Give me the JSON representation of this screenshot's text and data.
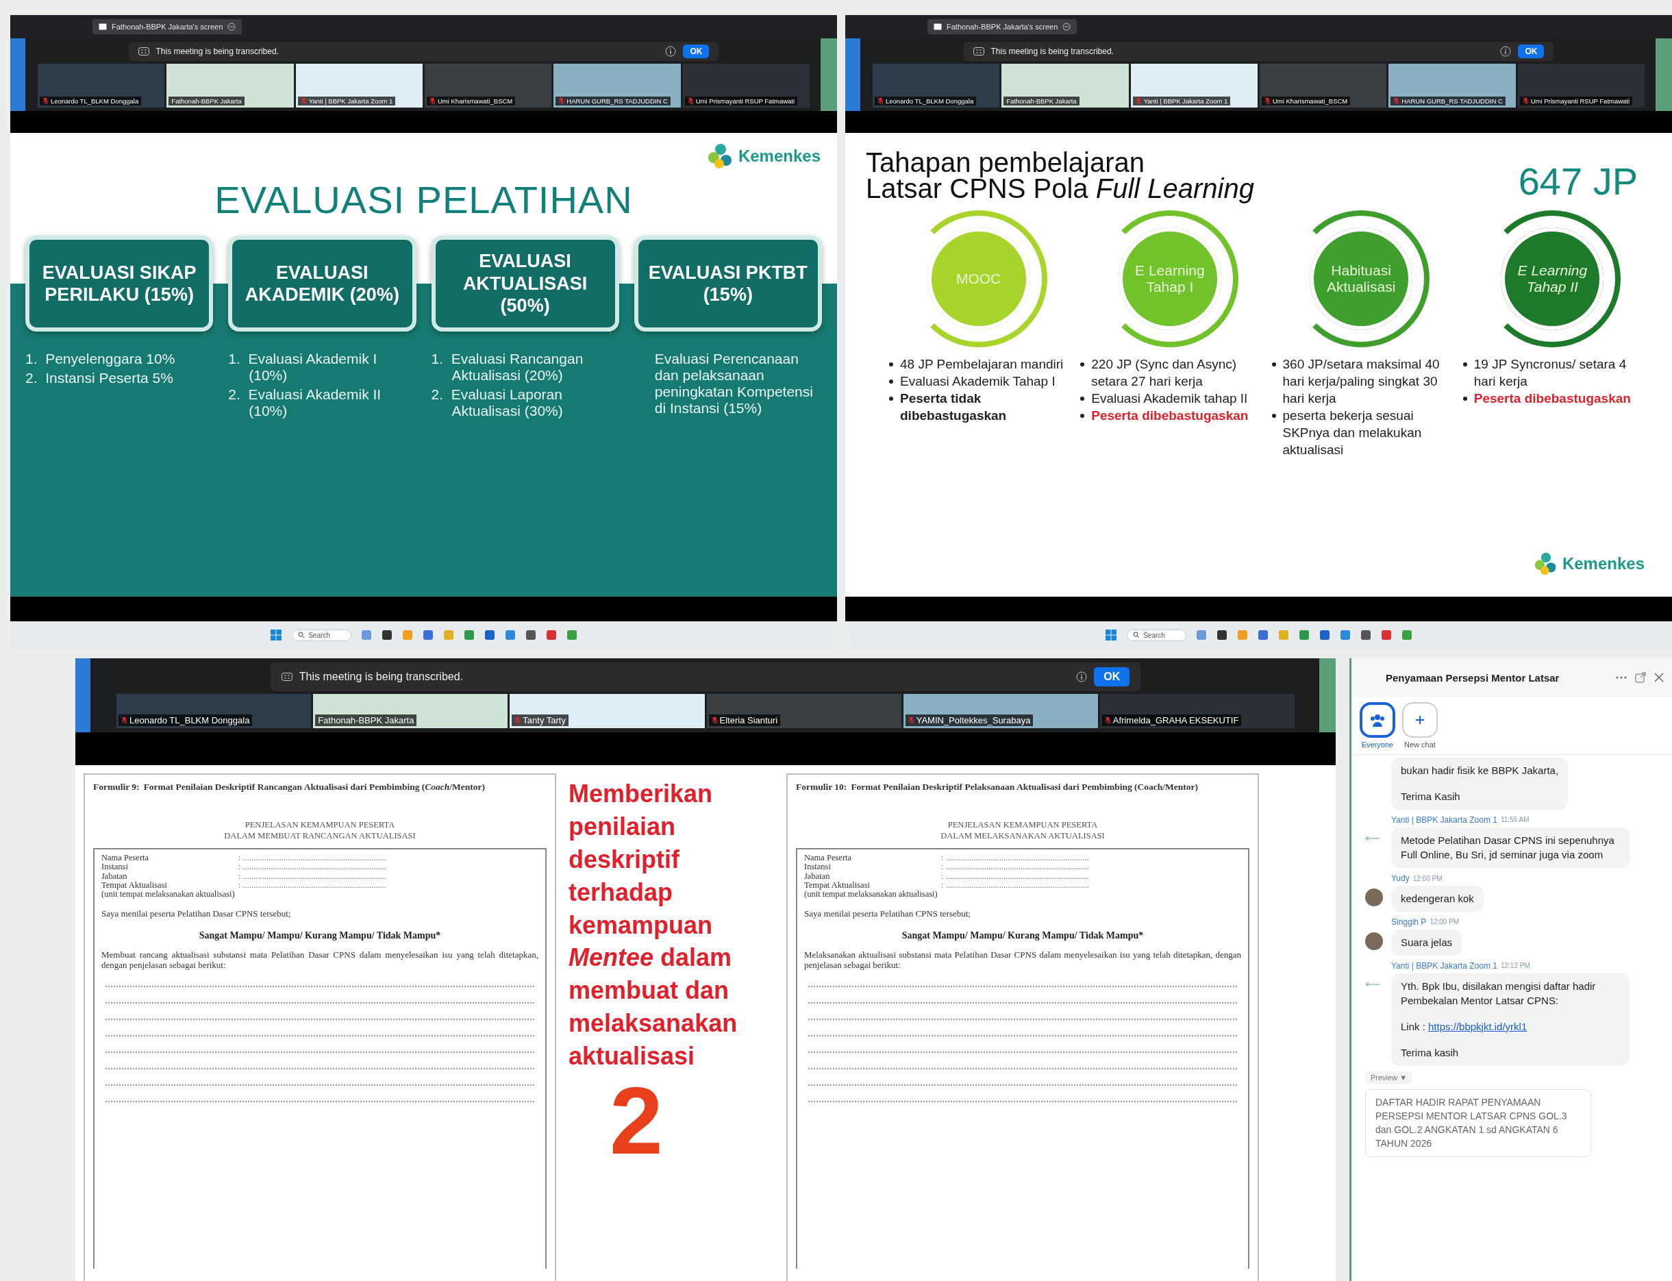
{
  "screens": [
    {
      "share_tab": "Fathonah-BBPK Jakarta's screen",
      "banner": {
        "text": "This meeting is being transcribed.",
        "button": "OK"
      },
      "participants": [
        {
          "name": "Leonardo TL_BLKM Donggala",
          "muted": true
        },
        {
          "name": "Fathonah-BBPK Jakarta",
          "muted": false
        },
        {
          "name": "Yanti | BBPK Jakarta Zoom 1",
          "muted": true
        },
        {
          "name": "Umi Kharismawati_BSCM",
          "muted": true
        },
        {
          "name": "HARUN GURB_RS TADJUDDIN C",
          "muted": true
        },
        {
          "name": "Umi Prismayanti RSUP Fatmawati",
          "muted": true
        }
      ],
      "slide": {
        "kind": "evaluasi",
        "logo": "Kemenkes",
        "title": "EVALUASI PELATIHAN",
        "cards": [
          {
            "title": "EVALUASI SIKAP PERILAKU (15%)",
            "items": [
              {
                "number": "1.",
                "text": "Penyelenggara 10%"
              },
              {
                "number": "2.",
                "text": "Instansi Peserta 5%"
              }
            ]
          },
          {
            "title": "EVALUASI AKADEMIK (20%)",
            "items": [
              {
                "number": "1.",
                "text": "Evaluasi Akademik I (10%)"
              },
              {
                "number": "2.",
                "text": "Evaluasi Akademik II (10%)"
              }
            ]
          },
          {
            "title": "EVALUASI AKTUALISASI (50%)",
            "items": [
              {
                "number": "1.",
                "text": "Evaluasi Rancangan Aktualisasi (20%)"
              },
              {
                "number": "2.",
                "text": "Evaluasi Laporan Aktualisasi (30%)"
              }
            ]
          },
          {
            "title": "EVALUASI PKTBT (15%)",
            "items": [
              {
                "text": "Evaluasi Perencanaan dan pelaksanaan peningkatan Kompetensi di Instansi (15%)"
              }
            ]
          }
        ]
      },
      "taskbar": {
        "search": "Search"
      }
    },
    {
      "share_tab": "Fathonah-BBPK Jakarta's screen",
      "banner": {
        "text": "This meeting is being transcribed.",
        "button": "OK"
      },
      "participants": [
        {
          "name": "Leonardo TL_BLKM Donggala",
          "muted": true
        },
        {
          "name": "Fathonah-BBPK Jakarta",
          "muted": false
        },
        {
          "name": "Yanti | BBPK Jakarta Zoom 1",
          "muted": true
        },
        {
          "name": "Umi Kharismawati_BSCM",
          "muted": true
        },
        {
          "name": "HARUN GURB_RS TADJUDDIN C",
          "muted": true
        },
        {
          "name": "Umi Prismayanti RSUP Fatmawati",
          "muted": true
        }
      ],
      "slide": {
        "kind": "tahapan",
        "title_lines": [
          "Tahapan pembelajaran",
          "Latsar CPNS Pola *Full Learning*"
        ],
        "total": "647 JP",
        "logo": "Kemenkes",
        "stages": [
          {
            "label": "MOOC",
            "italic": false,
            "color": "#a8d42c",
            "bullets": [
              {
                "kind": "plain",
                "text": "48 JP Pembelajaran mandiri"
              },
              {
                "kind": "plain",
                "text": "Evaluasi Akademik Tahap I"
              },
              {
                "kind": "bold",
                "text": "Peserta tidak dibebastugaskan"
              }
            ]
          },
          {
            "label": "E Learning Tahap I",
            "italic": false,
            "color": "#72c22c",
            "bullets": [
              {
                "kind": "plain",
                "text": "220 JP (Sync dan Async) setara 27 hari kerja"
              },
              {
                "kind": "plain",
                "text": "Evaluasi Akademik tahap II"
              },
              {
                "kind": "alert",
                "text": "Peserta dibebastugaskan"
              }
            ]
          },
          {
            "label": "Habituasi Aktualisasi",
            "italic": false,
            "color": "#3e9f2c",
            "bullets": [
              {
                "kind": "plain",
                "text": "360 JP/setara maksimal 40 hari kerja/paling singkat 30 hari kerja"
              },
              {
                "kind": "plain",
                "text": "peserta bekerja sesuai SKPnya dan melakukan aktualisasi"
              }
            ]
          },
          {
            "label": "E Learning Tahap II",
            "italic": true,
            "color": "#1d7a2a",
            "bullets": [
              {
                "kind": "plain",
                "text": "19 JP Syncronus/ setara 4 hari kerja"
              },
              {
                "kind": "alert",
                "text": "Peserta dibebastugaskan"
              }
            ]
          }
        ]
      },
      "taskbar": {
        "search": "Search"
      }
    }
  ],
  "main_meeting": {
    "banner": {
      "text": "This meeting is being transcribed.",
      "button": "OK"
    },
    "participants": [
      {
        "name": "Leonardo TL_BLKM Donggala",
        "muted": true
      },
      {
        "name": "Fathonah-BBPK Jakarta",
        "muted": false
      },
      {
        "name": "Tanty Tarty",
        "muted": true
      },
      {
        "name": "Elteria Sianturi",
        "muted": true
      },
      {
        "name": "YAMIN_Poltekkes_Surabaya",
        "muted": true
      },
      {
        "name": "Afrimelda_GRAHA EKSEKUTIF",
        "muted": true
      }
    ],
    "document": {
      "forms": [
        {
          "label": "Formulir 9:",
          "title": "Format Penilaian Deskriptif Rancangan Aktualisasi dari Pembimbing (*Coach*/Mentor)",
          "heading": [
            "PENJELASAN KEMAMPUAN PESERTA",
            "DALAM MEMBUAT RANCANGAN AKTUALISASI"
          ],
          "fields": [
            {
              "label": "Nama Peserta",
              "value": ": ..................................................................."
            },
            {
              "label": "Instansi",
              "value": ": ..................................................................."
            },
            {
              "label": "Jabatan",
              "value": ": ..................................................................."
            },
            {
              "label": "Tempat Aktualisasi",
              "value": ": ..................................................................."
            }
          ],
          "note": "(unit tempat melaksanakan aktualisasi)",
          "statement": "Saya menilai peserta Pelatihan Dasar CPNS tersebut;",
          "options": "Sangat Mampu/ Mampu/ Kurang Mampu/ Tidak Mampu*",
          "description": "Membuat rancang aktualisasi substansi mata Pelatihan Dasar CPNS dalam menyelesaikan isu yang telah ditetapkan, dengan penjelasan sebagai berikut:"
        },
        {
          "label": "Formulir 10:",
          "title": "Format Penilaian Deskriptif Pelaksanaan Aktualisasi dari Pembimbing (Coach/Mentor)",
          "heading": [
            "PENJELASAN KEMAMPUAN PESERTA",
            "DALAM MELAKSANAKAN AKTUALISASI"
          ],
          "fields": [
            {
              "label": "Nama Peserta",
              "value": ": ..................................................................."
            },
            {
              "label": "Instansi",
              "value": ": ..................................................................."
            },
            {
              "label": "Jabatan",
              "value": ": ..................................................................."
            },
            {
              "label": "Tempat Aktualisasi",
              "value": ": ..................................................................."
            }
          ],
          "note": "(unit tempat melaksanakan aktualisasi)",
          "statement": "Saya menilai peserta Pelatihan CPNS tersebut;",
          "options": "Sangat Mampu/ Mampu/ Kurang Mampu/ Tidak Mampu*",
          "description": "Melaksanakan aktualisasi substansi mata Pelatihan Dasar CPNS dalam menyelesaikan isu yang telah ditetapkan, dengan penjelasan sebagai berikut:"
        }
      ],
      "callout": "Memberikan penilaian deskriptif terhadap kemampuan *Mentee* dalam membuat dan melaksanakan aktualisasi",
      "callout_number": "2"
    }
  },
  "chat": {
    "title": "Penyamaan Persepsi Mentor Latsar",
    "tabs": [
      {
        "label": "Everyone",
        "selected": true
      },
      {
        "label": "New chat",
        "selected": false
      }
    ],
    "messages": [
      {
        "kind": "continued",
        "paragraphs": [
          {
            "text": "bukan hadir fisik ke BBPK Jakarta,"
          },
          {
            "text": "Terima Kasih"
          }
        ]
      },
      {
        "kind": "forwarded",
        "sender": "Yanti | BBPK Jakarta Zoom 1",
        "time": "11:55 AM",
        "paragraphs": [
          {
            "text": "Metode Pelatihan Dasar CPNS ini sepenuhnya Full Online, Bu Sri, jd seminar juga via zoom"
          }
        ]
      },
      {
        "kind": "avatar",
        "sender": "Yudy",
        "time": "12:00 PM",
        "paragraphs": [
          {
            "text": "kedengeran kok"
          }
        ]
      },
      {
        "kind": "avatar",
        "sender": "Singgih P",
        "time": "12:00 PM",
        "paragraphs": [
          {
            "text": "Suara jelas"
          }
        ]
      },
      {
        "kind": "forwarded",
        "sender": "Yanti | BBPK Jakarta Zoom 1",
        "time": "12:12 PM",
        "paragraphs": [
          {
            "text": "Yth. Bpk Ibu, disilakan mengisi daftar hadir Pembekalan Mentor Latsar CPNS:"
          },
          {
            "label": "Link :",
            "url": "https://bbpkjkt.id/yrkl1"
          },
          {
            "text": "Terima kasih"
          }
        ]
      }
    ],
    "preview_toggle": "Preview ▼",
    "preview": "DAFTAR HADIR RAPAT PENYAMAAN PERSEPSI MENTOR LATSAR CPNS GOL.3 dan GOL.2 ANGKATAN 1 sd ANGKATAN 6 TAHUN 2026"
  }
}
